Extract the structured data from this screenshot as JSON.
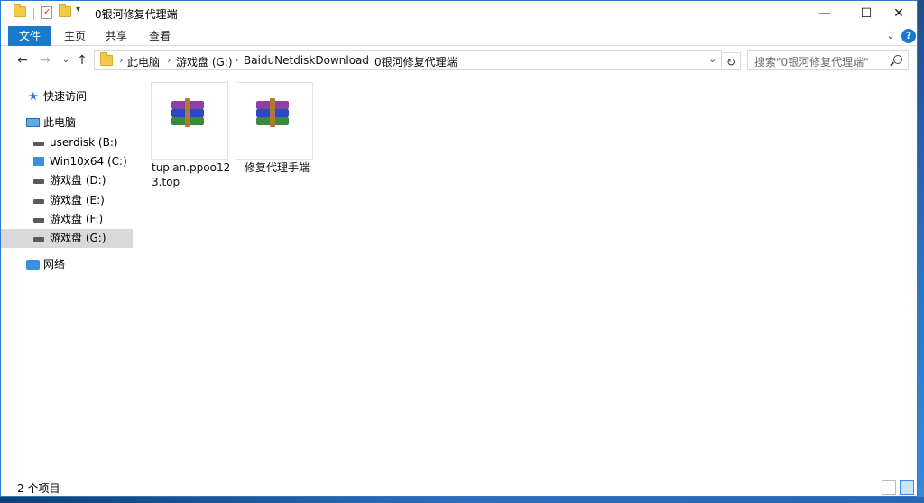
{
  "title": "0银河修复代理端",
  "window_controls": {
    "minimize": "—",
    "maximize": "☐",
    "close": "✕"
  },
  "ribbon": {
    "file": "文件",
    "tabs": [
      "主页",
      "共享",
      "查看"
    ]
  },
  "address": {
    "parts": [
      "此电脑",
      "游戏盘 (G:)",
      "BaiduNetdiskDownload",
      "0银河修复代理端"
    ]
  },
  "search": {
    "placeholder": "搜索\"0银河修复代理端\""
  },
  "nav": {
    "quick_access": "快速访问",
    "this_pc": "此电脑",
    "drives": [
      {
        "label": "userdisk (B:)",
        "icon": "drive-icon"
      },
      {
        "label": "Win10x64 (C:)",
        "icon": "windows-drive-icon"
      },
      {
        "label": "游戏盘 (D:)",
        "icon": "drive-icon"
      },
      {
        "label": "游戏盘 (E:)",
        "icon": "drive-icon"
      },
      {
        "label": "游戏盘 (F:)",
        "icon": "drive-icon"
      },
      {
        "label": "游戏盘 (G:)",
        "icon": "drive-icon",
        "selected": true
      }
    ],
    "network": "网络"
  },
  "files": [
    {
      "name": "tupian.ppoo123.top",
      "icon": "winrar-archive-icon"
    },
    {
      "name": "修复代理手端",
      "icon": "winrar-archive-icon"
    }
  ],
  "status": {
    "count": "2 个项目"
  },
  "colors": {
    "accent": "#1979ca",
    "selection": "#d9d9d9"
  }
}
